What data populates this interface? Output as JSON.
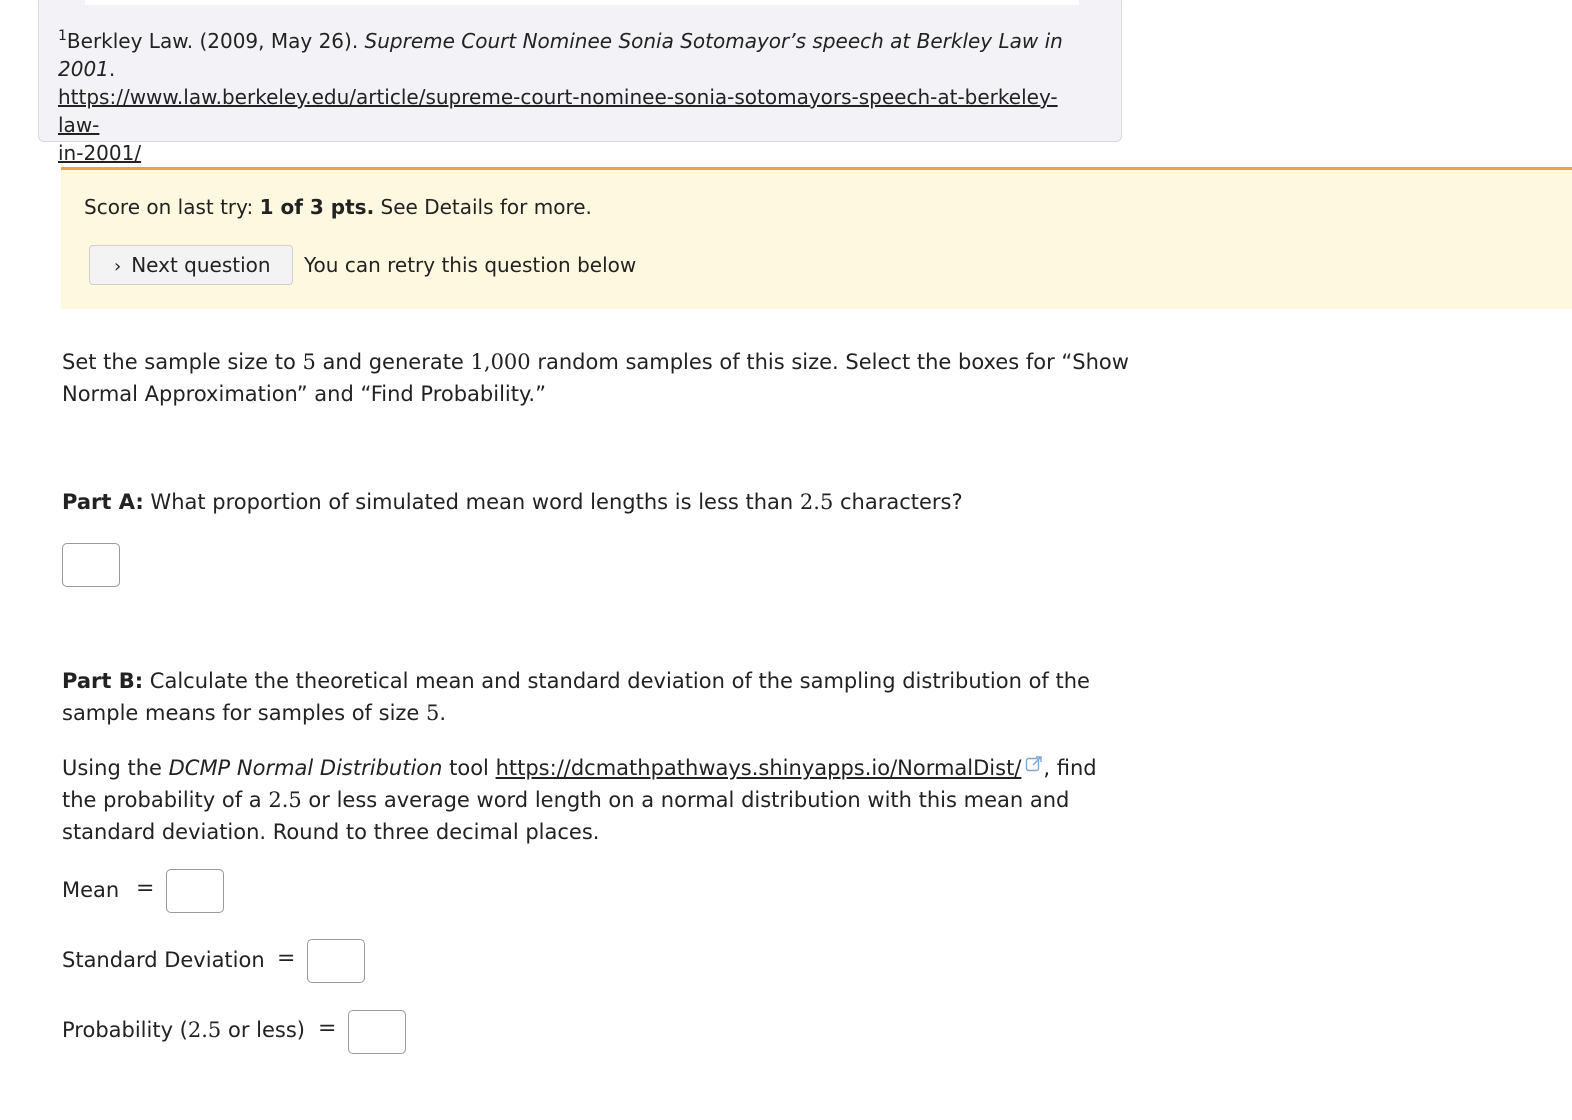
{
  "citation": {
    "number": "1",
    "text": "Berkley Law. (2009, May 26). ",
    "title": "Supreme Court Nominee Sonia Sotomayor’s speech at Berkley Law in 2001",
    "title_end": ".",
    "url_line1": "https://www.law.berkeley.edu/article/supreme-court-nominee-sonia-sotomayors-speech-at-berkeley-law-",
    "url_line2": "in-2001/"
  },
  "banner": {
    "score_prefix": "Score on last try: ",
    "score_value": "1 of 3 pts.",
    "score_suffix": " See Details for more.",
    "next_button": "Next question",
    "retry_text": "You can retry this question below"
  },
  "instructions": {
    "t1": "Set the sample size to ",
    "n": "5",
    "t2": " and generate ",
    "samples": "1,000",
    "t3": " random samples of this size. Select the boxes for “Show",
    "t4": "Normal Approximation” and “Find Probability.”"
  },
  "part_a": {
    "label": "Part A:",
    "t1": " What proportion of simulated mean word lengths is less than ",
    "value": "2.5",
    "t2": " characters?",
    "answer": ""
  },
  "part_b": {
    "label": "Part B:",
    "t1": " Calculate the theoretical mean and standard deviation of the sampling distribution of the",
    "t2": "sample means for samples of size ",
    "n": "5",
    "t3": ".",
    "u1": "Using the ",
    "tool": "DCMP Normal Distribution",
    "u2": " tool ",
    "link": "https://dcmathpathways.shinyapps.io/NormalDist/",
    "u3": ", find",
    "u4": "the probability of a ",
    "value": "2.5",
    "u5": " or less average word length on a normal distribution with this mean and",
    "u6": "standard deviation. Round to three decimal places.",
    "mean_label": "Mean",
    "sd_label": "Standard Deviation",
    "prob_label_1": "Probability (",
    "prob_value": "2.5",
    "prob_label_2": " or less)",
    "equals": "=",
    "mean_answer": "",
    "sd_answer": "",
    "prob_answer": ""
  }
}
